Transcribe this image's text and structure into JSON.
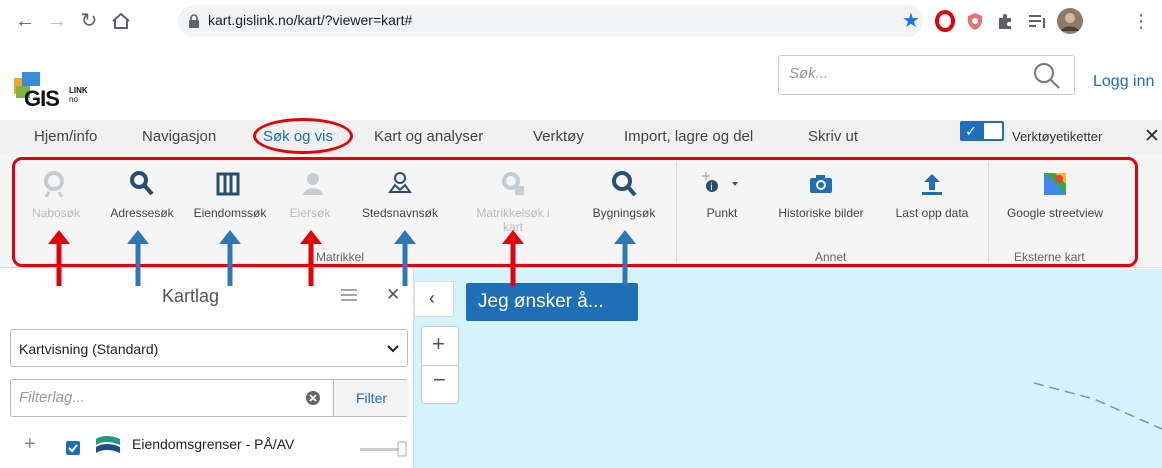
{
  "browser": {
    "url": "kart.gislink.no/kart/?viewer=kart#"
  },
  "header": {
    "logo_text": "GIS",
    "logo_sup_top": "LINK",
    "logo_sup_bottom": "no",
    "search_placeholder": "Søk...",
    "login_label": "Logg inn"
  },
  "tabs": [
    {
      "label": "Hjem/info"
    },
    {
      "label": "Navigasjon"
    },
    {
      "label": "Søk og vis"
    },
    {
      "label": "Kart og analyser"
    },
    {
      "label": "Verktøy"
    },
    {
      "label": "Import, lagre og del"
    },
    {
      "label": "Skriv ut"
    }
  ],
  "tooltips_toggle_label": "Verktøyetiketter",
  "tools": [
    {
      "label": "Nabosøk"
    },
    {
      "label": "Adressesøk"
    },
    {
      "label": "Eiendomssøk"
    },
    {
      "label": "Eiersøk"
    },
    {
      "label": "Stedsnavnsøk"
    },
    {
      "label": "Matrikkelsøk i kart"
    },
    {
      "label": "Bygningsøk"
    },
    {
      "label": "Punkt"
    },
    {
      "label": "Historiske bilder"
    },
    {
      "label": "Last opp data"
    },
    {
      "label": "Google streetview"
    }
  ],
  "groups": {
    "matrikkel": "Matrikkel",
    "annet": "Annet",
    "eksterne": "Eksterne kart"
  },
  "sidebar": {
    "title": "Kartlag",
    "basemap_selected": "Kartvisning (Standard)",
    "filter_placeholder": "Filterlag...",
    "filter_button": "Filter",
    "layer_name": "Eiendomsgrenser - PÅ/AV"
  },
  "map": {
    "action_button": "Jeg ønsker å..."
  },
  "colors": {
    "accent": "#1e6fb5",
    "annotation_red": "#e3000b",
    "annotation_blue": "#2f78b8",
    "map_water": "#d4f3fb"
  }
}
